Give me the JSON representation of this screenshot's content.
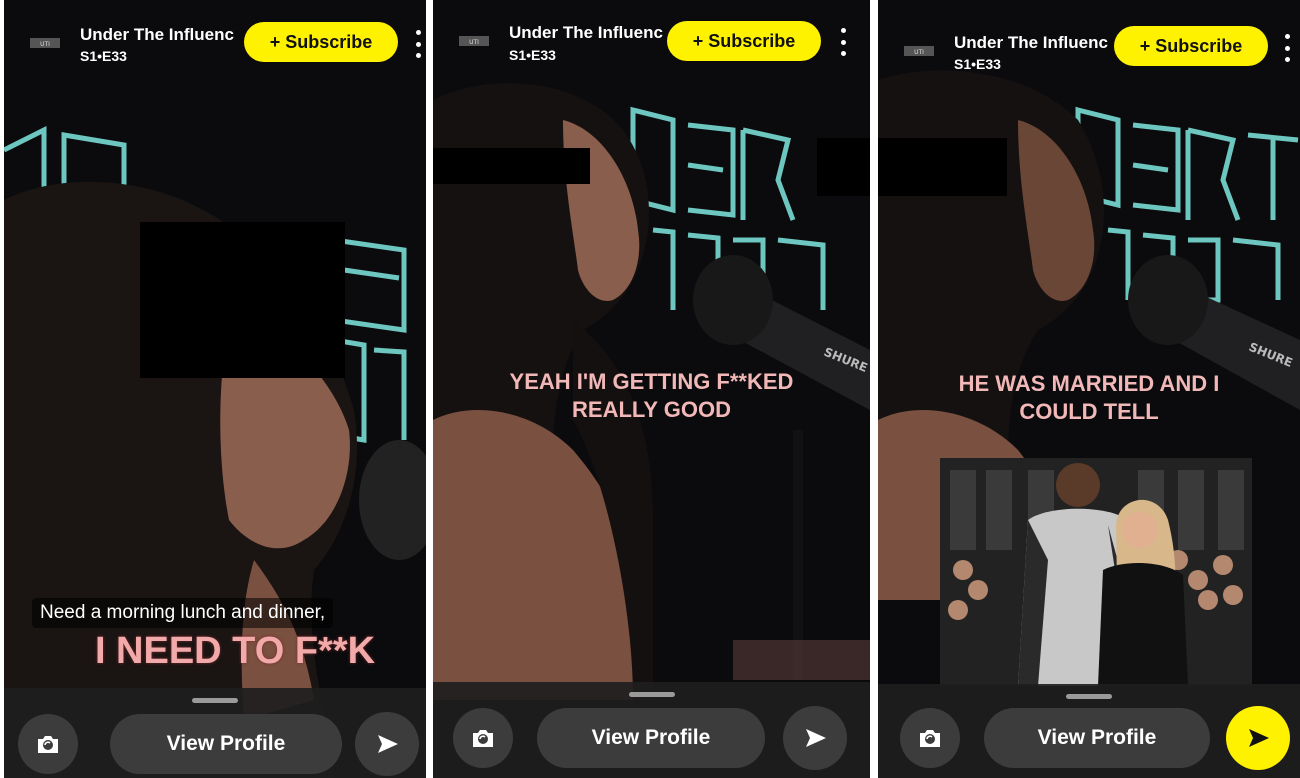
{
  "colors": {
    "subscribe_bg": "#FFF200",
    "caption_pink": "#f2b8b8",
    "neon_cyan": "#7fe8e0"
  },
  "icons": [
    "show-logo-icon",
    "more-vertical-icon",
    "camera-switch-icon",
    "send-arrow-icon"
  ],
  "panels": [
    {
      "header": {
        "title": "Under The Influenc",
        "episode": "S1•E33",
        "subscribe_label": "+ Subscribe"
      },
      "caption_line": "Need a morning lunch and dinner,",
      "caption_big": "I NEED TO F**K",
      "bottom": {
        "view_profile": "View Profile"
      }
    },
    {
      "header": {
        "title": "Under The Influenc",
        "episode": "S1•E33",
        "subscribe_label": "+ Subscribe"
      },
      "caption_lines": [
        "YEAH I'M GETTING F**KED",
        "REALLY GOOD"
      ],
      "bottom": {
        "view_profile": "View Profile"
      }
    },
    {
      "header": {
        "title": "Under The Influenc",
        "episode": "S1•E33",
        "subscribe_label": "+ Subscribe"
      },
      "caption_lines": [
        "HE WAS MARRIED AND I",
        "COULD TELL"
      ],
      "bottom": {
        "view_profile": "View Profile"
      }
    }
  ]
}
